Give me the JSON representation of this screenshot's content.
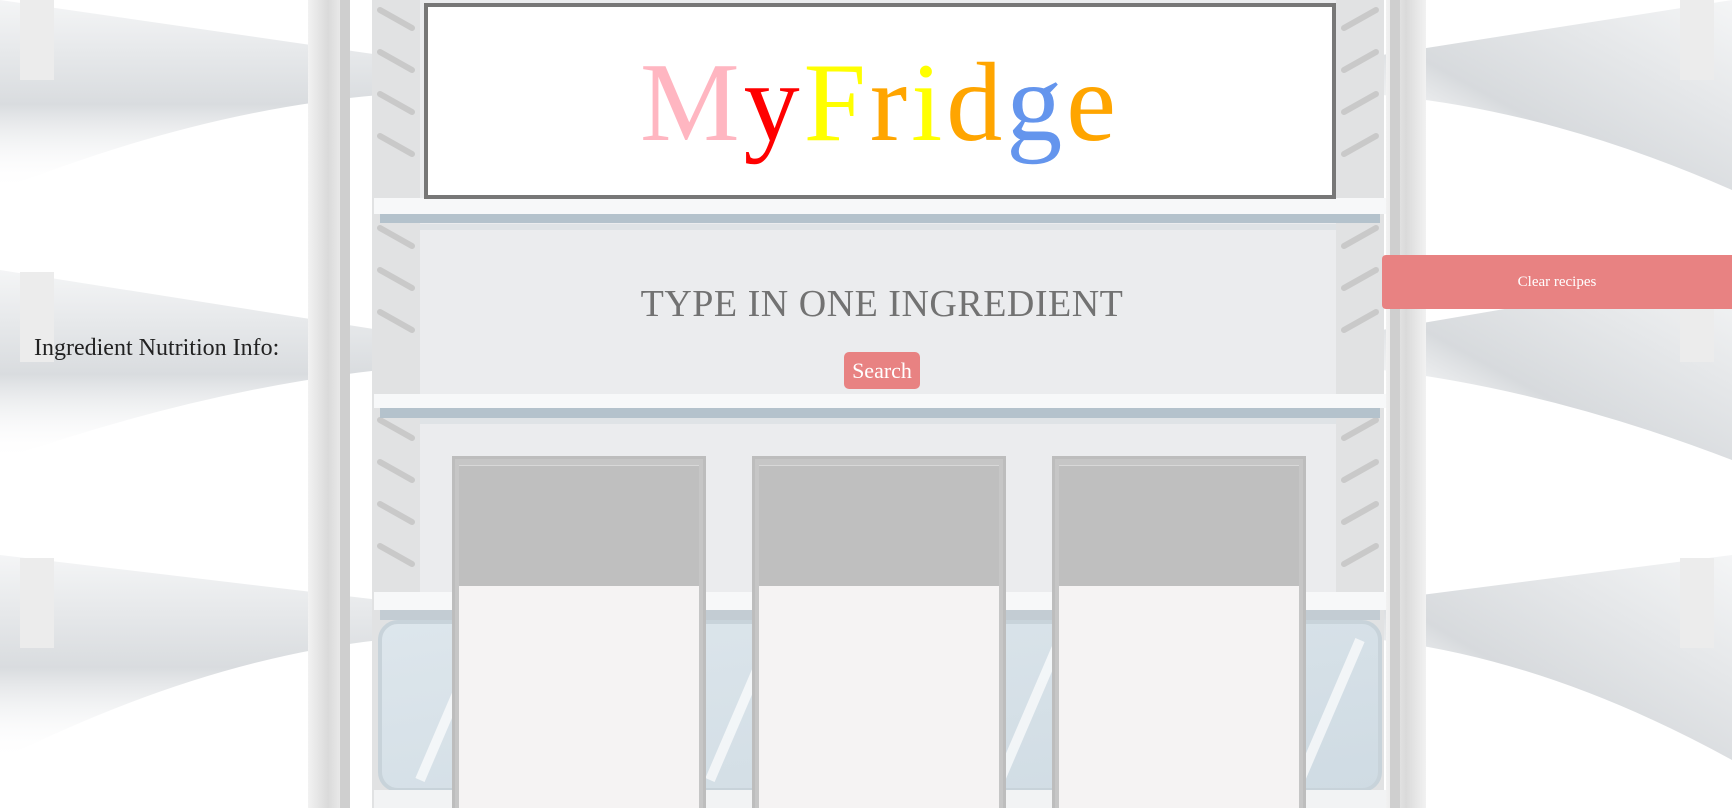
{
  "app": {
    "logo_letters": [
      {
        "char": "M",
        "color": "#ffb6c1"
      },
      {
        "char": "y",
        "color": "#ff0000"
      },
      {
        "char": "F",
        "color": "#ffff00"
      },
      {
        "char": "r",
        "color": "#ffa500"
      },
      {
        "char": "i",
        "color": "#ffff00"
      },
      {
        "char": "d",
        "color": "#ffa500"
      },
      {
        "char": "g",
        "color": "#6495ed"
      },
      {
        "char": "e",
        "color": "#ffa500"
      }
    ]
  },
  "search": {
    "prompt": "TYPE IN ONE INGREDIENT",
    "button_label": "Search"
  },
  "sidebar": {
    "nutrition_label": "Ingredient Nutrition Info:",
    "clear_label": "Clear recipes"
  },
  "colors": {
    "accent": "#e88282",
    "card_image": "#bfbfbf",
    "card_body": "#f5f3f3"
  },
  "recipes": [
    {},
    {},
    {}
  ]
}
